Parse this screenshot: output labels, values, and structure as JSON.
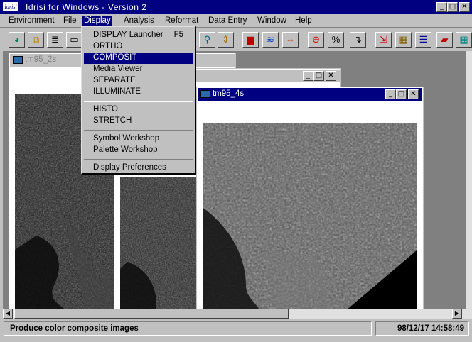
{
  "window": {
    "title": "Idrisi for Windows  -  Version 2",
    "logo_text": "Idrisi",
    "buttons": {
      "minimize": "_",
      "maximize": "□",
      "close": "✕"
    }
  },
  "menubar": [
    {
      "label": "Environment"
    },
    {
      "label": "File"
    },
    {
      "label": "Display"
    },
    {
      "label": "Analysis"
    },
    {
      "label": "Reformat"
    },
    {
      "label": "Data Entry"
    },
    {
      "label": "Window"
    },
    {
      "label": "Help"
    }
  ],
  "display_menu": {
    "items": [
      {
        "label": "DISPLAY Launcher",
        "shortcut": "F5"
      },
      {
        "label": "ORTHO"
      },
      {
        "label": "COMPOSIT"
      },
      {
        "label": "Media Viewer"
      },
      {
        "label": "SEPARATE"
      },
      {
        "label": "ILLUMINATE"
      },
      {
        "label": "HISTO"
      },
      {
        "label": "STRETCH"
      },
      {
        "label": "Symbol Workshop"
      },
      {
        "label": "Palette Workshop"
      },
      {
        "label": "Display Preferences"
      }
    ],
    "highlighted": "COMPOSIT"
  },
  "toolbar": {
    "buttons": [
      {
        "icon": "globe-icon",
        "glyph": "◕"
      },
      {
        "icon": "layers-icon",
        "glyph": "⧉"
      },
      {
        "icon": "list-icon",
        "glyph": "≣"
      },
      {
        "icon": "printer-icon",
        "glyph": "▭"
      },
      {
        "icon": "zoom-icon",
        "glyph": "⚲"
      },
      {
        "icon": "updown-icon",
        "glyph": "⇕"
      },
      {
        "icon": "histogram-icon",
        "glyph": "▆"
      },
      {
        "icon": "waves-icon",
        "glyph": "≋"
      },
      {
        "icon": "leftright-icon",
        "glyph": "⇔"
      },
      {
        "icon": "target-icon",
        "glyph": "⊕"
      },
      {
        "icon": "percent-icon",
        "glyph": "%"
      },
      {
        "icon": "arrow-icon",
        "glyph": "↴"
      },
      {
        "icon": "import-icon",
        "glyph": "⇲"
      },
      {
        "icon": "table-icon",
        "glyph": "▦"
      },
      {
        "icon": "legend-icon",
        "glyph": "☰"
      },
      {
        "icon": "erase-icon",
        "glyph": "▰"
      },
      {
        "icon": "grid-icon",
        "glyph": "▦"
      }
    ]
  },
  "mdi_windows": [
    {
      "title": "tm95_2s"
    },
    {
      "title": ""
    },
    {
      "title": "tm95_4s"
    }
  ],
  "status": {
    "message": "Produce color composite images",
    "datetime": "98/12/17 14:58:49"
  },
  "colors": {
    "title_active": "#000080",
    "face": "#c0c0c0",
    "workspace": "#808080"
  }
}
